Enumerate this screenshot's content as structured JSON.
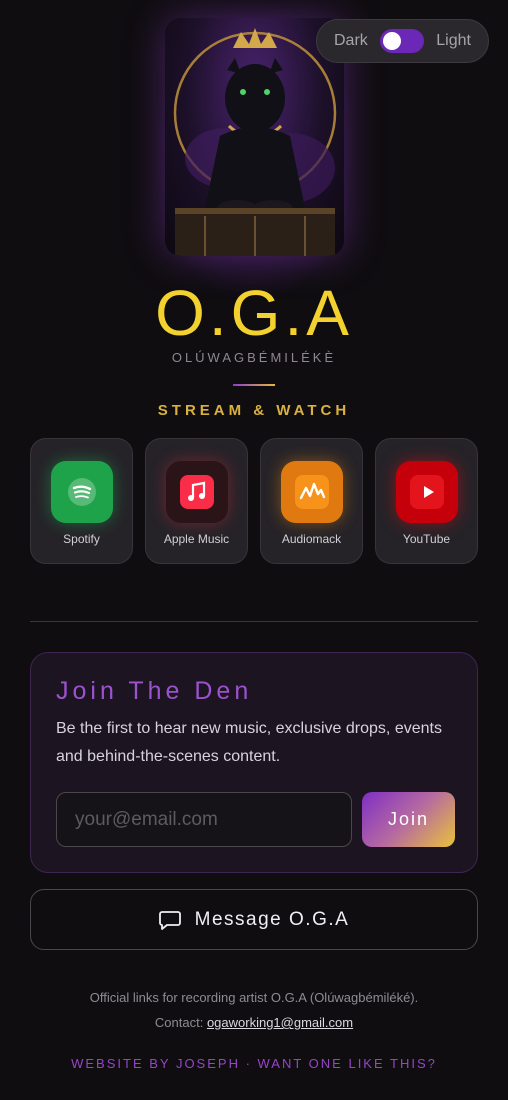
{
  "theme_toggle": {
    "dark_label": "Dark",
    "light_label": "Light",
    "state": "dark"
  },
  "cover": {
    "alt": "O.G.A cover art",
    "icon": "crowned-panther-image"
  },
  "artist": {
    "name": "O.G.A",
    "subtitle": "OLÚWAGBÉMILÉKÈ"
  },
  "stream": {
    "title": "STREAM & WATCH",
    "platforms": [
      {
        "label": "Spotify",
        "icon": "spotify-icon",
        "color": "#1db954"
      },
      {
        "label": "Apple Music",
        "icon": "apple-music-icon",
        "color": "#fa2d48"
      },
      {
        "label": "Audiomack",
        "icon": "audiomack-icon",
        "color": "#f38b0e"
      },
      {
        "label": "YouTube",
        "icon": "youtube-icon",
        "color": "#e00d16"
      }
    ]
  },
  "join": {
    "title": "Join The Den",
    "description": "Be the first to hear new music, exclusive drops, events and behind-the-scenes content.",
    "email_placeholder": "your@email.com",
    "email_value": "",
    "button_label": "Join"
  },
  "message": {
    "label": "Message O.G.A",
    "icon": "chat-bubble-icon"
  },
  "footer": {
    "line1": "Official links for recording artist O.G.A (Olúwagbémiléké).",
    "contact_prefix": "Contact:",
    "contact_email": "ogaworking1@gmail.com",
    "credit": "WEBSITE BY JOSEPH · WANT ONE LIKE THIS?"
  },
  "colors": {
    "accent_gold": "#f3d22f",
    "accent_purple": "#9b52cf",
    "background": "#0f0d10"
  }
}
